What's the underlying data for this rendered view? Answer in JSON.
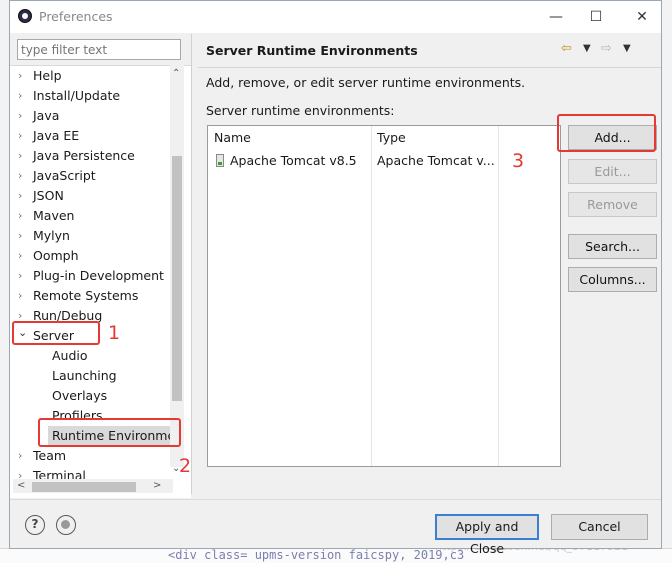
{
  "window": {
    "title": "Preferences"
  },
  "filter": {
    "placeholder": "type filter text"
  },
  "tree": [
    {
      "label": "Help",
      "expanded": false,
      "indent": 0
    },
    {
      "label": "Install/Update",
      "expanded": false,
      "indent": 0
    },
    {
      "label": "Java",
      "expanded": false,
      "indent": 0
    },
    {
      "label": "Java EE",
      "expanded": false,
      "indent": 0
    },
    {
      "label": "Java Persistence",
      "expanded": false,
      "indent": 0
    },
    {
      "label": "JavaScript",
      "expanded": false,
      "indent": 0
    },
    {
      "label": "JSON",
      "expanded": false,
      "indent": 0
    },
    {
      "label": "Maven",
      "expanded": false,
      "indent": 0
    },
    {
      "label": "Mylyn",
      "expanded": false,
      "indent": 0
    },
    {
      "label": "Oomph",
      "expanded": false,
      "indent": 0
    },
    {
      "label": "Plug-in Development",
      "expanded": false,
      "indent": 0
    },
    {
      "label": "Remote Systems",
      "expanded": false,
      "indent": 0
    },
    {
      "label": "Run/Debug",
      "expanded": false,
      "indent": 0
    },
    {
      "label": "Server",
      "expanded": true,
      "indent": 0
    },
    {
      "label": "Audio",
      "indent": 1
    },
    {
      "label": "Launching",
      "indent": 1
    },
    {
      "label": "Overlays",
      "indent": 1
    },
    {
      "label": "Profilers",
      "indent": 1
    },
    {
      "label": "Runtime Environme",
      "indent": 1,
      "selected": true
    },
    {
      "label": "Team",
      "expanded": false,
      "indent": 0
    },
    {
      "label": "Terminal",
      "expanded": false,
      "indent": 0
    }
  ],
  "page": {
    "title": "Server Runtime Environments",
    "description": "Add, remove, or edit server runtime environments.",
    "list_label": "Server runtime environments:"
  },
  "table": {
    "columns": [
      "Name",
      "Type"
    ],
    "rows": [
      {
        "name": "Apache Tomcat v8.5",
        "type": "Apache Tomcat v..."
      }
    ]
  },
  "buttons": {
    "add": "Add...",
    "edit": "Edit...",
    "remove": "Remove",
    "search": "Search...",
    "columns": "Columns..."
  },
  "footer": {
    "apply_close": "Apply and Close",
    "cancel": "Cancel"
  },
  "annotations": {
    "one": "1",
    "two": "2",
    "three": "3"
  },
  "background": {
    "code_fragment": "<div class= upms-version faicspy, 2019,c3",
    "watermark": "https://blog.csdn.net/qq_37117521"
  },
  "colors": {
    "annotation": "#e53935",
    "primary_border": "#3c7fd0",
    "selection": "#d9d9d9"
  }
}
